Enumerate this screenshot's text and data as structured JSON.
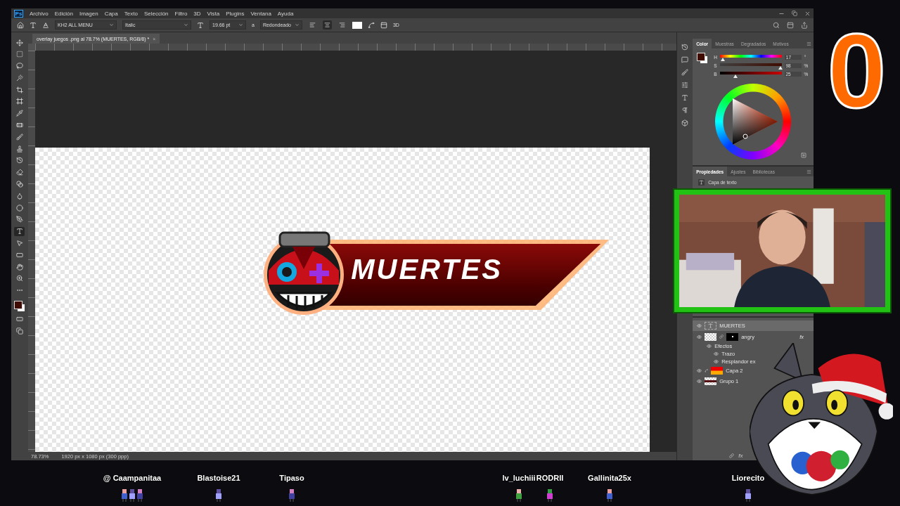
{
  "photoshop": {
    "app_logo": "Ps",
    "menu": [
      "Archivo",
      "Edición",
      "Imagen",
      "Capa",
      "Texto",
      "Selección",
      "Filtro",
      "3D",
      "Vista",
      "Plugins",
      "Ventana",
      "Ayuda"
    ],
    "options": {
      "font": "KH2 ALL MENU",
      "style": "Italic",
      "size": "19.66 pt",
      "antialias_symbol": "a",
      "antialias": "Redondeado",
      "align": [
        {
          "kind": "left",
          "selected": false
        },
        {
          "kind": "center",
          "selected": true
        },
        {
          "kind": "right",
          "selected": false
        }
      ],
      "three_d": "3D"
    },
    "document_tab": {
      "title": "overlay juegos .png al 78.7% (MUERTES, RGB/8) *",
      "close": "×"
    },
    "tools": [
      {
        "kind": "move",
        "selected": false
      },
      {
        "kind": "marquee",
        "selected": false
      },
      {
        "kind": "lasso",
        "selected": false
      },
      {
        "kind": "wand",
        "selected": false
      },
      {
        "kind": "crop",
        "selected": false
      },
      {
        "kind": "frame",
        "selected": false
      },
      {
        "kind": "eyedropper",
        "selected": false
      },
      {
        "kind": "healing",
        "selected": false
      },
      {
        "kind": "brush",
        "selected": false
      },
      {
        "kind": "stamp",
        "selected": false
      },
      {
        "kind": "history",
        "selected": false
      },
      {
        "kind": "eraser",
        "selected": false
      },
      {
        "kind": "gradient",
        "selected": false
      },
      {
        "kind": "smudge",
        "selected": false
      },
      {
        "kind": "dodge",
        "selected": false
      },
      {
        "kind": "pen",
        "selected": false
      },
      {
        "kind": "type",
        "selected": true
      },
      {
        "kind": "select",
        "selected": false
      },
      {
        "kind": "rectangle",
        "selected": false
      },
      {
        "kind": "hand",
        "selected": false
      },
      {
        "kind": "zoom",
        "selected": false
      },
      {
        "kind": "more",
        "selected": false
      }
    ],
    "canvas": {
      "banner_text": "MUERTES"
    },
    "status": {
      "zoom": "78.73%",
      "size": "1920 px x 1080 px (300 ppp)"
    },
    "color_panel": {
      "tabs": [
        {
          "label": "Color",
          "selected": true
        },
        {
          "label": "Muestras",
          "selected": false
        },
        {
          "label": "Degradados",
          "selected": false
        },
        {
          "label": "Motivos",
          "selected": false
        }
      ],
      "sliders": [
        {
          "label": "H",
          "value": "17",
          "unit": "°",
          "level": 0.05
        },
        {
          "label": "S",
          "value": "98",
          "unit": "%",
          "level": 0.98
        },
        {
          "label": "B",
          "value": "25",
          "unit": "%",
          "level": 0.25
        }
      ]
    },
    "properties_panel": {
      "tabs": [
        {
          "label": "Propiedades",
          "selected": true
        },
        {
          "label": "Ajustes",
          "selected": false
        },
        {
          "label": "Bibliotecas",
          "selected": false
        }
      ],
      "layer_type": "Capa de texto"
    },
    "layers": [
      {
        "kind": "text",
        "name": "MUERTES",
        "selected": true
      },
      {
        "kind": "smart",
        "name": "angry",
        "fx": "fx",
        "selected": false,
        "children": [
          {
            "name": "Efectos",
            "children": [
              {
                "name": "Trazo"
              },
              {
                "name": "Resplandor ex"
              }
            ]
          }
        ]
      },
      {
        "kind": "fill",
        "name": "Capa 2",
        "selected": false
      },
      {
        "kind": "group",
        "name": "Grupo 1",
        "selected": false
      }
    ],
    "layers_footer_fx": "fx"
  },
  "stream": {
    "death_counter": "0",
    "viewers": [
      {
        "name": "@ Caampanitaa"
      },
      {
        "name": "Blastoise21"
      },
      {
        "name": "Tipaso"
      },
      {
        "name": "lv_luchiii"
      },
      {
        "name": "RODRII"
      },
      {
        "name": "Gallinita25x"
      },
      {
        "name": "Liorecito"
      }
    ]
  }
}
